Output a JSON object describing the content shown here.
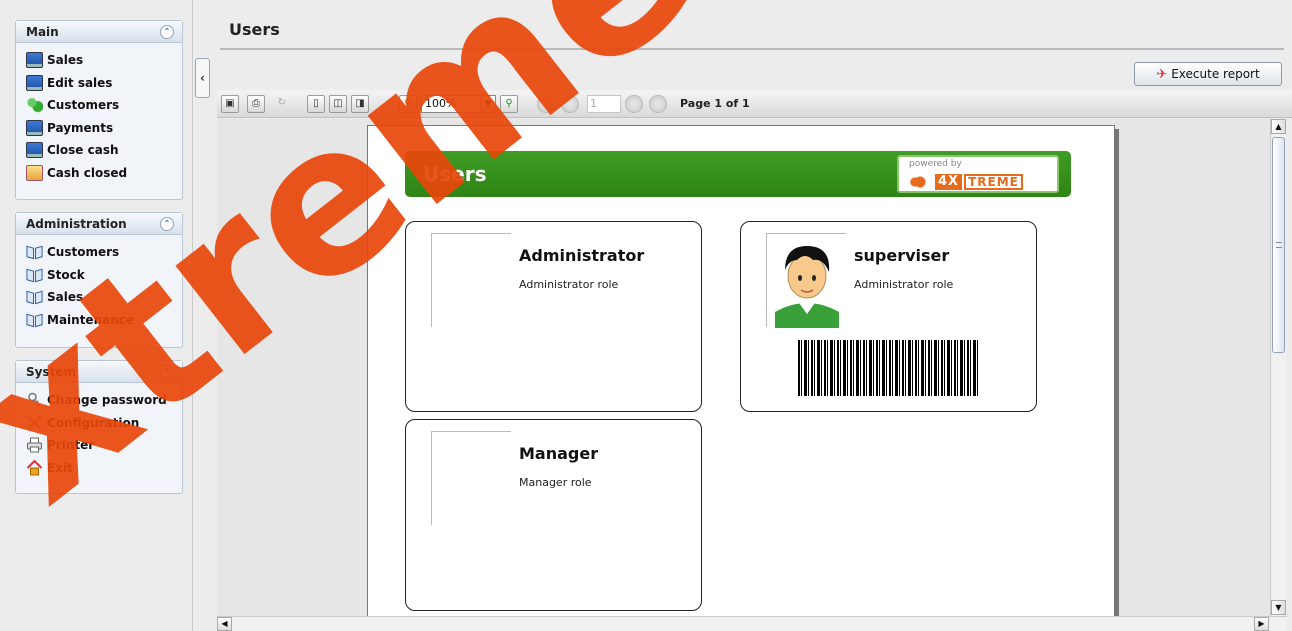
{
  "sidebar": {
    "panels": [
      {
        "title": "Main",
        "items": [
          {
            "label": "Sales",
            "icon": "screen-icon"
          },
          {
            "label": "Edit sales",
            "icon": "screen-icon"
          },
          {
            "label": "Customers",
            "icon": "people-icon"
          },
          {
            "label": "Payments",
            "icon": "screen-icon"
          },
          {
            "label": "Close cash",
            "icon": "screen-icon"
          },
          {
            "label": "Cash closed",
            "icon": "calendar-icon"
          }
        ]
      },
      {
        "title": "Administration",
        "items": [
          {
            "label": "Customers",
            "icon": "book-icon"
          },
          {
            "label": "Stock",
            "icon": "book-icon"
          },
          {
            "label": "Sales",
            "icon": "book-icon"
          },
          {
            "label": "Maintenance",
            "icon": "book-icon"
          }
        ]
      },
      {
        "title": "System",
        "items": [
          {
            "label": "Change password",
            "icon": "key-icon"
          },
          {
            "label": "Configuration",
            "icon": "tools-icon"
          },
          {
            "label": "Printer",
            "icon": "printer-icon"
          },
          {
            "label": "Exit",
            "icon": "home-icon"
          }
        ]
      }
    ]
  },
  "header": {
    "title": "Users",
    "execute_label": "Execute report"
  },
  "toolbar": {
    "zoom": "100%",
    "page_input": "1",
    "page_status": "Page 1 of 1"
  },
  "report": {
    "title": "Users",
    "powered_by": "powered by",
    "logo_4x": "4X",
    "logo_treme": "TREME",
    "cards": [
      {
        "name": "Administrator",
        "role": "Administrator role",
        "has_photo": false,
        "has_barcode": false
      },
      {
        "name": "superviser",
        "role": "Administrator role",
        "has_photo": true,
        "has_barcode": true
      },
      {
        "name": "Manager",
        "role": "Manager role",
        "has_photo": false,
        "has_barcode": false
      }
    ]
  },
  "watermark": "xtreme",
  "colors": {
    "report_banner": "#3f9c25",
    "watermark": "#e8460a",
    "logo_orange": "#e86b1b"
  }
}
